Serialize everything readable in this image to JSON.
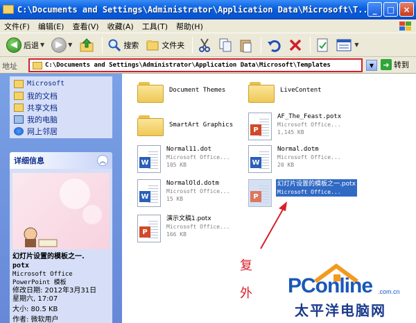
{
  "window": {
    "title": "C:\\Documents and Settings\\Administrator\\Application Data\\Microsoft\\T...",
    "minimize": "_",
    "maximize": "□",
    "close": "×"
  },
  "menu": [
    "文件(F)",
    "编辑(E)",
    "查看(V)",
    "收藏(A)",
    "工具(T)",
    "帮助(H)"
  ],
  "toolbar": {
    "back_label": "后退",
    "search_label": "搜索",
    "folders_label": "文件夹"
  },
  "address": {
    "label": "地址",
    "path": "C:\\Documents and Settings\\Administrator\\Application Data\\Microsoft\\Templates",
    "go_label": "转到"
  },
  "places": [
    "Microsoft",
    "我的文档",
    "共享文档",
    "我的电脑",
    "网上邻居"
  ],
  "details": {
    "heading": "详细信息",
    "name_line1": "幻灯片设置的模板之一.",
    "name_line2": "potx",
    "type_line1": "Microsoft Office",
    "type_line2": "PowerPoint 模板",
    "modified_line1": "修改日期: 2012年3月31日",
    "modified_line2": "星期六, 17:07",
    "size": "大小: 80.5 KB",
    "author": "作者: 微软用户"
  },
  "files": [
    {
      "name": "Document Themes",
      "kind": "folder"
    },
    {
      "name": "LiveContent",
      "kind": "folder"
    },
    {
      "name": "SmartArt Graphics",
      "kind": "folder"
    },
    {
      "name": "AF_The_Feast.potx",
      "type": "Microsoft Office...",
      "size": "1,145 KB",
      "kind": "ppt"
    },
    {
      "name": "Normal11.dot",
      "type": "Microsoft Office...",
      "size": "105 KB",
      "kind": "word"
    },
    {
      "name": "Normal.dotm",
      "type": "Microsoft Office...",
      "size": "20 KB",
      "kind": "word"
    },
    {
      "name": "NormalOld.dotm",
      "type": "Microsoft Office...",
      "size": "15 KB",
      "kind": "word"
    },
    {
      "name": "幻灯片设置的模板之一.potx",
      "type": "Microsoft Office...",
      "kind": "ppt"
    },
    {
      "name": "演示文稿1.potx",
      "type": "Microsoft Office...",
      "size": "166 KB",
      "kind": "ppt"
    }
  ],
  "annotations": [
    "复",
    "外"
  ],
  "watermark": {
    "brand": "PConline",
    "domain": ".com.cn",
    "cn": "太平洋电脑网"
  }
}
